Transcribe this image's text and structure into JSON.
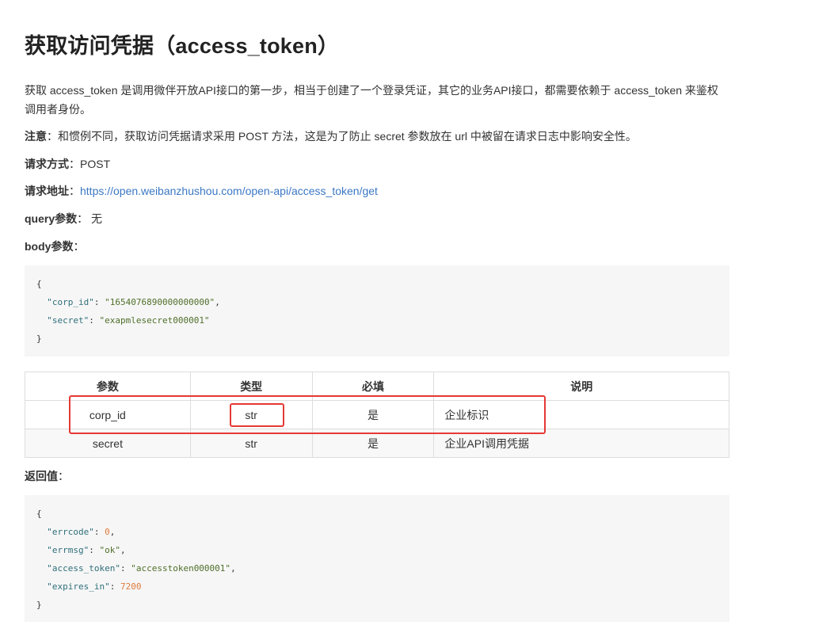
{
  "title": "获取访问凭据（access_token）",
  "intro": "获取 access_token 是调用微伴开放API接口的第一步，相当于创建了一个登录凭证，其它的业务API接口，都需要依赖于 access_token 来鉴权调用者身份。",
  "note": {
    "label": "注意",
    "text": "：和惯例不同，获取访问凭据请求采用 POST 方法，这是为了防止 secret 参数放在 url 中被留在请求日志中影响安全性。"
  },
  "method": {
    "label": "请求方式",
    "value": "：POST"
  },
  "url": {
    "label": "请求地址",
    "sep": "：",
    "link": "https://open.weibanzhushou.com/open-api/access_token/get"
  },
  "query": {
    "label": "query参数",
    "value": "： 无"
  },
  "body": {
    "label": "body参数",
    "value": "："
  },
  "body_code": {
    "open": "{",
    "corp_id_key": "\"corp_id\"",
    "corp_id_val": "\"1654076890000000000\"",
    "secret_key": "\"secret\"",
    "secret_val": "\"exapmlesecret000001\"",
    "close": "}"
  },
  "table": {
    "headers": [
      "参数",
      "类型",
      "必填",
      "说明"
    ],
    "rows": [
      [
        "corp_id",
        "str",
        "是",
        "企业标识"
      ],
      [
        "secret",
        "str",
        "是",
        "企业API调用凭据"
      ]
    ]
  },
  "return": {
    "label": "返回值",
    "value": "："
  },
  "return_code": {
    "open": "{",
    "errcode_key": "\"errcode\"",
    "errcode_val": "0",
    "errmsg_key": "\"errmsg\"",
    "errmsg_val": "\"ok\"",
    "token_key": "\"access_token\"",
    "token_val": "\"accesstoken000001\"",
    "expires_key": "\"expires_in\"",
    "expires_val": "7200",
    "close": "}"
  },
  "colors": {
    "link": "#3b78c4",
    "highlight": "#e53935",
    "code_bg": "#f6f6f6"
  }
}
